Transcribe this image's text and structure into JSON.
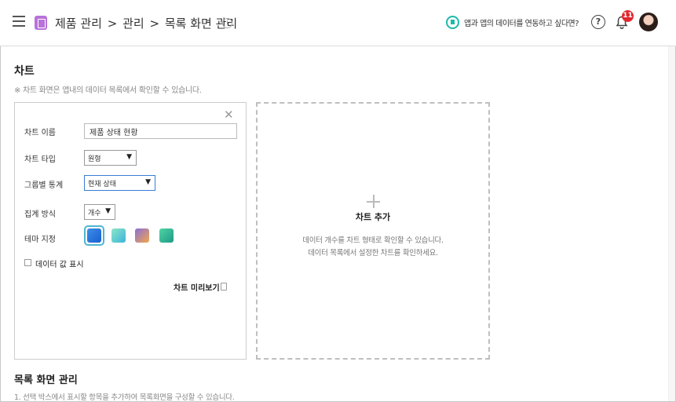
{
  "header": {
    "breadcrumb": [
      "제품 관리",
      ">",
      "관리",
      ">",
      "목록 화면 관리"
    ],
    "connect_text": "앱과 앱의 데이터를 연동하고 싶다면?",
    "notification_count": "11"
  },
  "chart_section": {
    "title": "차트",
    "note": "※ 차트 화면은 앱내의 데이터 목록에서 확인할 수 있습니다."
  },
  "settings": {
    "name_label": "차트 이름",
    "name_value": "제품 상태 현황",
    "type_label": "차트 타입",
    "type_value": "원형",
    "group_label": "그룹별 통계",
    "group_value": "현재 상태",
    "agg_label": "집계 방식",
    "agg_value": "개수",
    "theme_label": "테마 지정",
    "themes": [
      "blue",
      "teal",
      "purple-orange",
      "green"
    ],
    "show_values_label": "데이터 값 표시",
    "preview_label": "차트 미리보기"
  },
  "add_chart": {
    "title": "차트 추가",
    "desc_line1": "데이터 개수를 차트 형태로 확인할 수 있습니다.",
    "desc_line2": "데이터 목록에서 설정한 차트를 확인하세요."
  },
  "list_section": {
    "title": "목록 화면 관리",
    "note": "1. 선택 박스에서 표시할 항목을 추가하여 목록화면을 구성할 수 있습니다."
  }
}
